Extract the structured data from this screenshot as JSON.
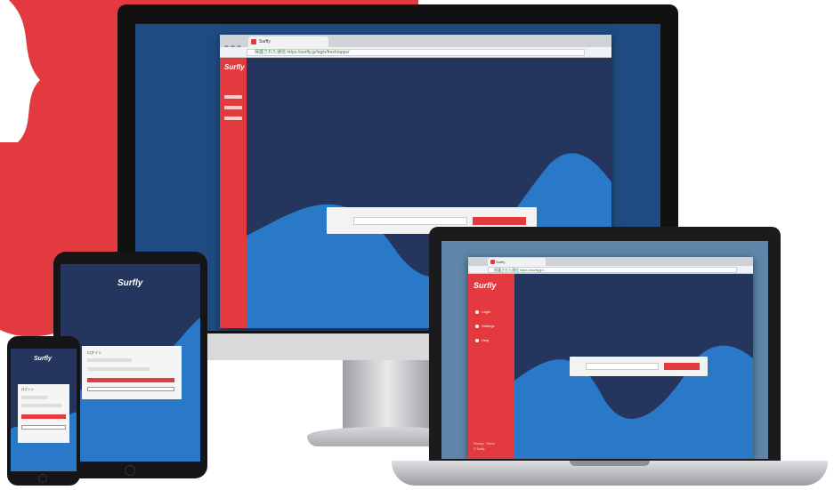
{
  "scene": {
    "description_colors": {
      "brand_red": "#e23a3e",
      "navy": "#24365e",
      "blue": "#2a78c8"
    }
  },
  "desktop": {
    "tab_label": "Surfly",
    "address": "保護された通信  https://surfly.jp/login/fresh/apps/",
    "logo": "Surfly",
    "search_placeholder": "",
    "search_button": ""
  },
  "laptop": {
    "tab_label": "Surfly",
    "address": "保護された通信  https://surfly.jp/...",
    "logo": "Surfly",
    "menu": [
      "Login",
      "Settings",
      "Help"
    ],
    "footer": [
      "Privacy · Terms",
      "© Surfly"
    ]
  },
  "tablet": {
    "logo": "Surfly",
    "form_title": "ログイン"
  },
  "phone": {
    "logo": "Surfly",
    "form_title": "ログイン"
  }
}
